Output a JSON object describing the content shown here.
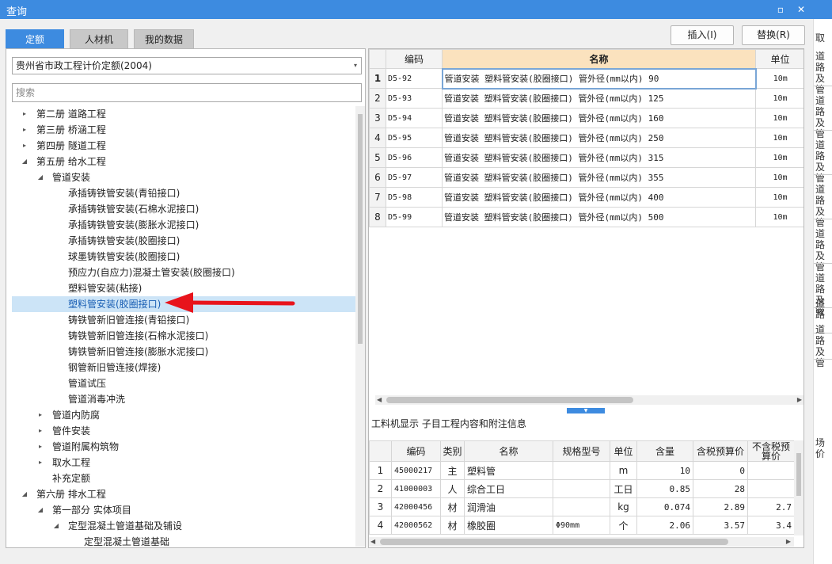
{
  "window": {
    "title": "查询",
    "maximize_glyph": "▫",
    "close_glyph": "✕"
  },
  "tabs": [
    {
      "label": "定额"
    },
    {
      "label": "人材机"
    },
    {
      "label": "我的数据"
    }
  ],
  "buttons": {
    "insert": "插入(I)",
    "replace": "替换(R)"
  },
  "library": {
    "selected": "贵州省市政工程计价定额(2004)",
    "arrow": "▾"
  },
  "search": {
    "placeholder": "搜索"
  },
  "tree": [
    {
      "label": "第二册 道路工程",
      "toggle": "▸"
    },
    {
      "label": "第三册 桥涵工程",
      "toggle": "▸"
    },
    {
      "label": "第四册 隧道工程",
      "toggle": "▸"
    },
    {
      "label": "第五册 给水工程",
      "toggle": "◢"
    },
    {
      "label": "管道安装",
      "toggle": "◢"
    },
    {
      "label": "承插铸铁管安装(青铅接口)",
      "toggle": ""
    },
    {
      "label": "承插铸铁管安装(石棉水泥接口)",
      "toggle": ""
    },
    {
      "label": "承插铸铁管安装(膨胀水泥接口)",
      "toggle": ""
    },
    {
      "label": "承插铸铁管安装(胶圈接口)",
      "toggle": ""
    },
    {
      "label": "球墨铸铁管安装(胶圈接口)",
      "toggle": ""
    },
    {
      "label": "预应力(自应力)混凝土管安装(胶圈接口)",
      "toggle": ""
    },
    {
      "label": "塑料管安装(粘接)",
      "toggle": ""
    },
    {
      "label": "塑料管安装(胶圈接口)",
      "toggle": ""
    },
    {
      "label": "铸铁管新旧管连接(青铅接口)",
      "toggle": ""
    },
    {
      "label": "铸铁管新旧管连接(石棉水泥接口)",
      "toggle": ""
    },
    {
      "label": "铸铁管新旧管连接(膨胀水泥接口)",
      "toggle": ""
    },
    {
      "label": "钢管新旧管连接(焊接)",
      "toggle": ""
    },
    {
      "label": "管道试压",
      "toggle": ""
    },
    {
      "label": "管道消毒冲洗",
      "toggle": ""
    },
    {
      "label": "管道内防腐",
      "toggle": "▸"
    },
    {
      "label": "管件安装",
      "toggle": "▸"
    },
    {
      "label": "管道附属构筑物",
      "toggle": "▸"
    },
    {
      "label": "取水工程",
      "toggle": "▸"
    },
    {
      "label": "补充定额",
      "toggle": ""
    },
    {
      "label": "第六册 排水工程",
      "toggle": "◢"
    },
    {
      "label": "第一部分 实体项目",
      "toggle": "◢"
    },
    {
      "label": "定型混凝土管道基础及铺设",
      "toggle": "◢"
    },
    {
      "label": "定型混凝土管道基础",
      "toggle": ""
    }
  ],
  "quota_table": {
    "headers": {
      "code": "编码",
      "name": "名称",
      "unit": "单位"
    },
    "rows": [
      {
        "n": "1",
        "code": "D5-92",
        "name": "管道安装 塑料管安装(胶圈接口) 管外径(mm以内) 90",
        "unit": "10m"
      },
      {
        "n": "2",
        "code": "D5-93",
        "name": "管道安装 塑料管安装(胶圈接口) 管外径(mm以内) 125",
        "unit": "10m"
      },
      {
        "n": "3",
        "code": "D5-94",
        "name": "管道安装 塑料管安装(胶圈接口) 管外径(mm以内) 160",
        "unit": "10m"
      },
      {
        "n": "4",
        "code": "D5-95",
        "name": "管道安装 塑料管安装(胶圈接口) 管外径(mm以内) 250",
        "unit": "10m"
      },
      {
        "n": "5",
        "code": "D5-96",
        "name": "管道安装 塑料管安装(胶圈接口) 管外径(mm以内) 315",
        "unit": "10m"
      },
      {
        "n": "6",
        "code": "D5-97",
        "name": "管道安装 塑料管安装(胶圈接口) 管外径(mm以内) 355",
        "unit": "10m"
      },
      {
        "n": "7",
        "code": "D5-98",
        "name": "管道安装 塑料管安装(胶圈接口) 管外径(mm以内) 400",
        "unit": "10m"
      },
      {
        "n": "8",
        "code": "D5-99",
        "name": "管道安装 塑料管安装(胶圈接口) 管外径(mm以内) 500",
        "unit": "10m"
      }
    ]
  },
  "detail": {
    "title": "工料机显示 子目工程内容和附注信息",
    "headers": {
      "code": "编码",
      "type": "类别",
      "name": "名称",
      "spec": "规格型号",
      "unit": "单位",
      "qty": "含量",
      "price_tax": "含税预算价",
      "price_notax": "不含税预算价"
    },
    "rows": [
      {
        "n": "1",
        "code": "45000217",
        "type": "主",
        "name": "塑料管",
        "spec": "",
        "unit": "m",
        "qty": "10",
        "price_tax": "0",
        "price_notax": ""
      },
      {
        "n": "2",
        "code": "41000003",
        "type": "人",
        "name": "综合工日",
        "spec": "",
        "unit": "工日",
        "qty": "0.85",
        "price_tax": "28",
        "price_notax": ""
      },
      {
        "n": "3",
        "code": "42000456",
        "type": "材",
        "name": "润滑油",
        "spec": "",
        "unit": "kg",
        "qty": "0.074",
        "price_tax": "2.89",
        "price_notax": "2.7"
      },
      {
        "n": "4",
        "code": "42000562",
        "type": "材",
        "name": "橡胶圈",
        "spec": "Φ90mm",
        "unit": "个",
        "qty": "2.06",
        "price_tax": "3.57",
        "price_notax": "3.4"
      }
    ]
  },
  "background": {
    "header": "取",
    "rows": [
      "道路 及管",
      "道路 及管",
      "道路 及管",
      "道路 及管",
      "道路 及管",
      "道路 及管",
      "道路",
      "道路 及管"
    ],
    "footer": "场价"
  },
  "colors": {
    "accent": "#3d8be0",
    "selected_row": "#cce4f7",
    "header_highlight": "#fbe2be",
    "arrow": "#e8141c"
  }
}
